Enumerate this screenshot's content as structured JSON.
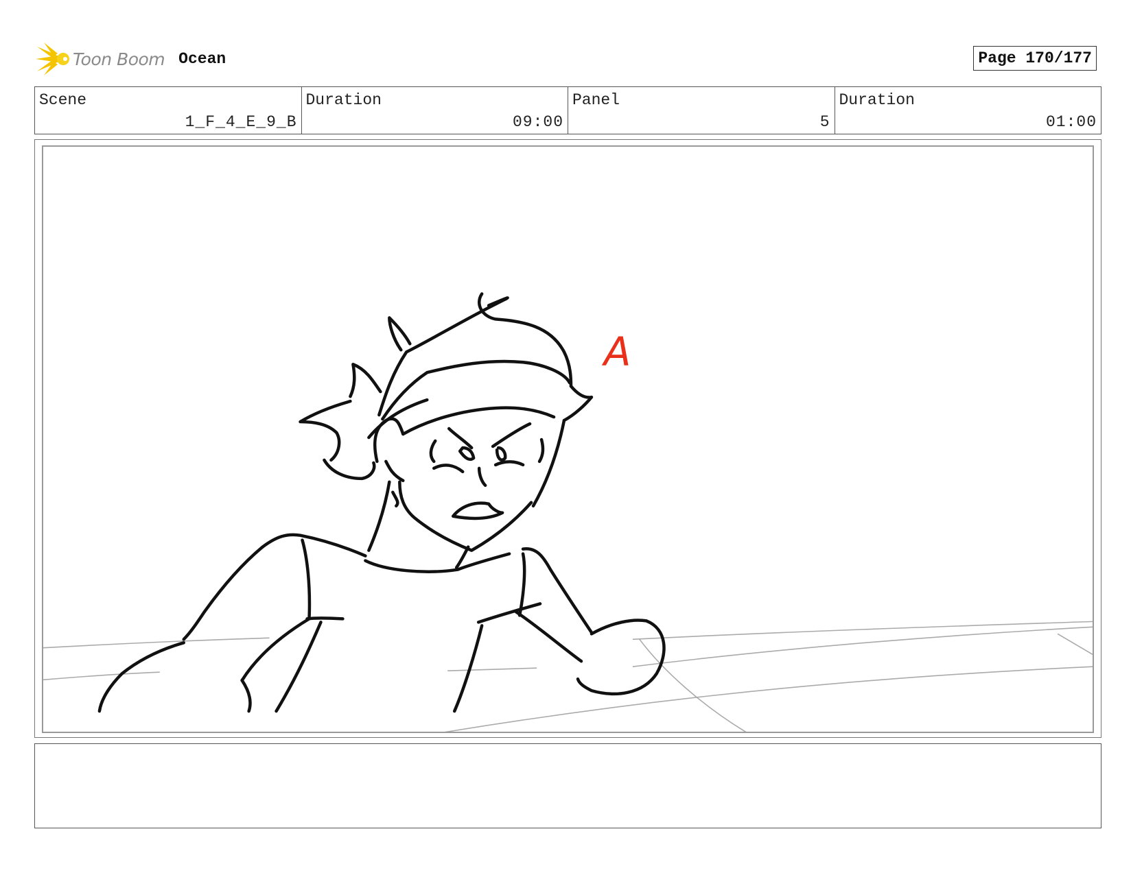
{
  "header": {
    "logo_text": "Toon Boom",
    "project_title": "Ocean",
    "page_label": "Page 170/177"
  },
  "info": {
    "scene_label": "Scene",
    "scene_value": "1_F_4_E_9_B",
    "scene_duration_label": "Duration",
    "scene_duration_value": "09:00",
    "panel_label": "Panel",
    "panel_value": "5",
    "panel_duration_label": "Duration",
    "panel_duration_value": "01:00"
  },
  "panel": {
    "annotation_letter": "A",
    "annotation_color": "#e8301a"
  },
  "notes": {
    "text": ""
  },
  "colors": {
    "logo_yellow": "#f5c400",
    "logo_text": "#8a8a8a"
  }
}
